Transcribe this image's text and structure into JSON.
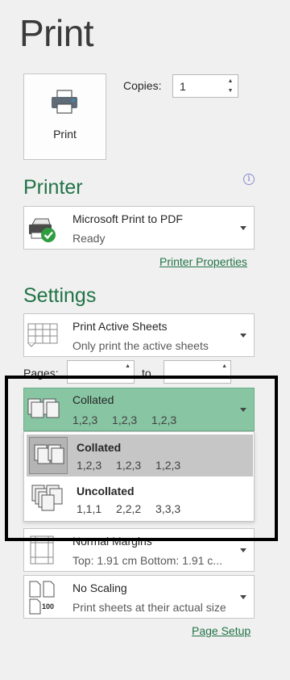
{
  "page": {
    "title": "Print"
  },
  "print_button": {
    "label": "Print"
  },
  "copies": {
    "label": "Copies:",
    "value": "1"
  },
  "printer": {
    "heading": "Printer",
    "name": "Microsoft Print to PDF",
    "status": "Ready",
    "properties_link": "Printer Properties"
  },
  "settings": {
    "heading": "Settings",
    "active_sheets": {
      "title": "Print Active Sheets",
      "subtitle": "Only print the active sheets"
    },
    "pages": {
      "label": "Pages:",
      "to_label": "to",
      "from_value": "",
      "to_value": ""
    },
    "collation": {
      "selected": {
        "title": "Collated",
        "detail": "1,2,3 1,2,3 1,2,3"
      },
      "options": [
        {
          "title": "Collated",
          "detail": "1,2,3 1,2,3 1,2,3",
          "selected": true
        },
        {
          "title": "Uncollated",
          "detail": "1,1,1 2,2,2 3,3,3",
          "selected": false
        }
      ]
    },
    "margins": {
      "title": "Normal Margins",
      "subtitle": "Top: 1.91 cm Bottom: 1.91 c..."
    },
    "scaling": {
      "title": "No Scaling",
      "subtitle": "Print sheets at their actual size",
      "icon_text": "100"
    },
    "page_setup_link": "Page Setup"
  },
  "colors": {
    "accent": "#217346",
    "selected_green": "#88c5a3",
    "option_selected": "#c6c6c6"
  },
  "icons": [
    "printer-icon",
    "info-icon",
    "pdf-printer-icon",
    "sheets-icon",
    "collated-icon",
    "uncollated-icon",
    "margins-icon",
    "no-scaling-icon"
  ]
}
